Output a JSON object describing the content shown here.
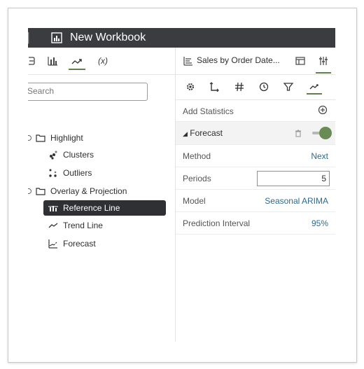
{
  "window": {
    "title": "New Workbook"
  },
  "left_panel": {
    "tabs": [
      {
        "name": "data-tab",
        "icon": "database-icon"
      },
      {
        "name": "visualizations-tab",
        "icon": "bar-chart-icon"
      },
      {
        "name": "analytics-tab",
        "icon": "trend-icon",
        "active": true
      },
      {
        "name": "calculations-tab",
        "label": "(x)"
      }
    ],
    "search": {
      "placeholder": "Search"
    },
    "tree": {
      "highlight": {
        "label": "Highlight",
        "children": [
          "Clusters",
          "Outliers"
        ]
      },
      "overlay": {
        "label": "Overlay & Projection",
        "children": [
          "Reference Line",
          "Trend Line",
          "Forecast"
        ],
        "selected": "Reference Line"
      }
    }
  },
  "right_panel": {
    "header": {
      "title": "Sales by Order Date..."
    },
    "add_statistics": "Add Statistics",
    "forecast_section": {
      "label": "Forecast",
      "enabled": true
    },
    "properties": {
      "method": {
        "label": "Method",
        "value": "Next"
      },
      "periods": {
        "label": "Periods",
        "value": "5"
      },
      "model": {
        "label": "Model",
        "value": "Seasonal ARIMA"
      },
      "prediction_interval": {
        "label": "Prediction Interval",
        "value": "95%"
      }
    }
  },
  "colors": {
    "titlebar": "#3a3c40",
    "accent_green": "#6a8a56",
    "link_blue": "#2d6a8e",
    "selected_row": "#2f3033"
  }
}
